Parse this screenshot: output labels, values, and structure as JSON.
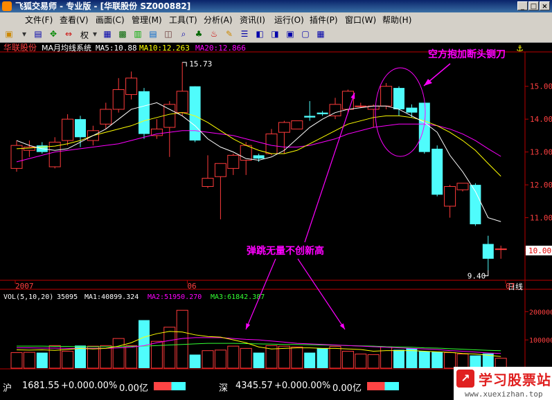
{
  "window": {
    "title": "飞狐交易师 - 专业版 - [华联股份 SZ000882]",
    "buttons": [
      "_",
      "□",
      "×"
    ]
  },
  "menu": [
    "文件(F)",
    "查看(V)",
    "画面(C)",
    "管理(M)",
    "工具(T)",
    "分析(A)",
    "资讯(I)",
    "运行(O)",
    "插件(P)",
    "窗口(W)",
    "帮助(H)"
  ],
  "toolbar": {
    "rights_label": "权"
  },
  "price_panel": {
    "stock_name": "华联股份",
    "indicator": "MA月均线系统",
    "ma5": "MA5:10.88",
    "ma10": "MA10:12.263",
    "ma20": "MA20:12.866",
    "high_label": "15.73",
    "low_label": "9.40",
    "last_price_tag": "10.00",
    "y_ticks": [
      "15.00",
      "14.00",
      "13.00",
      "12.00",
      "11.00",
      "10.00"
    ],
    "x_labels": [
      "2007",
      "06",
      "07"
    ],
    "period_label": "日线",
    "annotation_top": "空方抱加断头铡刀",
    "annotation_mid": "弹跳无量不创新高"
  },
  "volume_panel": {
    "indicator": "VOL(5,10,20)",
    "vol": "35095",
    "ma1": "MA1:40899.324",
    "ma2": "MA2:51950.270",
    "ma3": "MA3:61842.387",
    "y_ticks": [
      "200000",
      "100000"
    ]
  },
  "status": {
    "sh_label": "沪",
    "sh_value": "1681.55",
    "sh_change": "+0.00",
    "sh_pct": "0.00%",
    "sh_amount": "0.00亿",
    "sz_label": "深",
    "sz_value": "4345.57",
    "sz_change": "+0.00",
    "sz_pct": "0.00%",
    "sz_amount": "0.00亿"
  },
  "watermark": {
    "name": "学习股票站",
    "url": "www.xuexizhan.top"
  },
  "colors": {
    "up": "#ff3b3b",
    "down": "#4ffcfc",
    "ma5": "#ffffff",
    "ma10": "#ffff00",
    "ma20": "#ff00ff",
    "annotation": "#ff00ff"
  },
  "chart_data": {
    "type": "candlestick",
    "ylim": [
      9.2,
      15.9
    ],
    "volume_ylim": [
      0,
      240000
    ],
    "candles": [
      {
        "o": 12.5,
        "c": 13.2,
        "h": 13.35,
        "l": 12.4,
        "v": 55000
      },
      {
        "o": 13.05,
        "c": 13.15,
        "h": 13.35,
        "l": 12.85,
        "v": 56000
      },
      {
        "o": 13.2,
        "c": 13.0,
        "h": 13.3,
        "l": 12.95,
        "v": 55000
      },
      {
        "o": 12.55,
        "c": 13.3,
        "h": 13.45,
        "l": 12.5,
        "v": 80000
      },
      {
        "o": 13.35,
        "c": 14.0,
        "h": 14.15,
        "l": 13.2,
        "v": 60000
      },
      {
        "o": 14.0,
        "c": 13.45,
        "h": 14.1,
        "l": 13.15,
        "v": 80000
      },
      {
        "o": 13.35,
        "c": 13.65,
        "h": 13.8,
        "l": 13.2,
        "v": 78000
      },
      {
        "o": 13.85,
        "c": 14.3,
        "h": 14.5,
        "l": 13.7,
        "v": 80000
      },
      {
        "o": 14.3,
        "c": 14.9,
        "h": 15.25,
        "l": 14.2,
        "v": 105000
      },
      {
        "o": 14.75,
        "c": 15.25,
        "h": 15.45,
        "l": 14.6,
        "v": 80000
      },
      {
        "o": 14.85,
        "c": 13.55,
        "h": 14.95,
        "l": 13.4,
        "v": 170000
      },
      {
        "o": 13.5,
        "c": 13.7,
        "h": 14.0,
        "l": 13.4,
        "v": 95000
      },
      {
        "o": 13.75,
        "c": 14.45,
        "h": 14.55,
        "l": 12.85,
        "v": 145000
      },
      {
        "o": 14.2,
        "c": 14.85,
        "h": 15.73,
        "l": 14.1,
        "v": 205000
      },
      {
        "o": 15.0,
        "c": 13.35,
        "h": 15.0,
        "l": 13.3,
        "v": 48000
      },
      {
        "o": 11.95,
        "c": 12.2,
        "h": 12.9,
        "l": 11.9,
        "v": 62000
      },
      {
        "o": 12.25,
        "c": 12.65,
        "h": 12.65,
        "l": 10.95,
        "v": 64000
      },
      {
        "o": 12.5,
        "c": 12.9,
        "h": 12.95,
        "l": 12.3,
        "v": 78000
      },
      {
        "o": 12.75,
        "c": 13.2,
        "h": 13.3,
        "l": 12.3,
        "v": 70000
      },
      {
        "o": 12.9,
        "c": 12.8,
        "h": 12.95,
        "l": 12.7,
        "v": 55000
      },
      {
        "o": 12.95,
        "c": 13.55,
        "h": 13.7,
        "l": 12.9,
        "v": 80000
      },
      {
        "o": 13.6,
        "c": 13.9,
        "h": 13.95,
        "l": 12.95,
        "v": 78000
      },
      {
        "o": 13.7,
        "c": 13.95,
        "h": 13.95,
        "l": 13.7,
        "v": 75000
      },
      {
        "o": 14.1,
        "c": 14.05,
        "h": 14.55,
        "l": 13.95,
        "v": 55000
      },
      {
        "o": 14.2,
        "c": 14.15,
        "h": 14.25,
        "l": 14.1,
        "v": 70000
      },
      {
        "o": 14.1,
        "c": 14.45,
        "h": 14.65,
        "l": 14.0,
        "v": 77000
      },
      {
        "o": 14.3,
        "c": 14.85,
        "h": 14.9,
        "l": 14.2,
        "v": 60000
      },
      {
        "o": 14.4,
        "c": 14.4,
        "h": 14.5,
        "l": 14.35,
        "v": 50000
      },
      {
        "o": 14.3,
        "c": 14.4,
        "h": 14.45,
        "l": 13.75,
        "v": 48000
      },
      {
        "o": 14.4,
        "c": 15.0,
        "h": 15.1,
        "l": 14.3,
        "v": 75000
      },
      {
        "o": 14.95,
        "c": 14.3,
        "h": 15.0,
        "l": 14.1,
        "v": 65000
      },
      {
        "o": 14.35,
        "c": 14.2,
        "h": 14.45,
        "l": 14.05,
        "v": 70000
      },
      {
        "o": 14.5,
        "c": 13.0,
        "h": 14.5,
        "l": 12.95,
        "v": 60000
      },
      {
        "o": 13.1,
        "c": 11.7,
        "h": 13.2,
        "l": 11.65,
        "v": 58000
      },
      {
        "o": 11.35,
        "c": 11.95,
        "h": 12.0,
        "l": 11.0,
        "v": 55000
      },
      {
        "o": 11.85,
        "c": 12.05,
        "h": 12.05,
        "l": 11.8,
        "v": 50000
      },
      {
        "o": 12.0,
        "c": 10.8,
        "h": 12.05,
        "l": 10.75,
        "v": 45000
      },
      {
        "o": 10.2,
        "c": 9.75,
        "h": 10.45,
        "l": 9.4,
        "v": 52000
      },
      {
        "o": 10.05,
        "c": 10.05,
        "h": 10.15,
        "l": 9.75,
        "v": 35095
      }
    ],
    "ma5": [
      13.35,
      13.2,
      13.1,
      13.05,
      13.1,
      13.3,
      13.5,
      13.7,
      14.0,
      14.3,
      14.4,
      14.5,
      14.3,
      14.1,
      13.8,
      13.4,
      13.15,
      13.0,
      12.8,
      12.75,
      12.85,
      13.05,
      13.4,
      13.75,
      14.0,
      14.2,
      14.3,
      14.35,
      14.4,
      14.4,
      14.3,
      14.1,
      13.9,
      13.6,
      12.9,
      12.4,
      11.8,
      11.0,
      10.88
    ],
    "ma10": [
      13.1,
      13.12,
      13.15,
      13.18,
      13.25,
      13.35,
      13.5,
      13.6,
      13.7,
      13.8,
      13.95,
      14.05,
      14.15,
      14.2,
      14.1,
      13.9,
      13.65,
      13.4,
      13.2,
      13.05,
      12.95,
      12.95,
      13.05,
      13.25,
      13.45,
      13.65,
      13.85,
      13.95,
      14.05,
      14.1,
      14.1,
      14.05,
      13.95,
      13.8,
      13.6,
      13.35,
      13.05,
      12.65,
      12.263
    ],
    "ma20": [
      12.7,
      12.8,
      12.9,
      13.0,
      13.05,
      13.1,
      13.15,
      13.2,
      13.25,
      13.35,
      13.45,
      13.55,
      13.6,
      13.65,
      13.65,
      13.6,
      13.55,
      13.5,
      13.4,
      13.3,
      13.2,
      13.15,
      13.15,
      13.2,
      13.3,
      13.4,
      13.55,
      13.65,
      13.75,
      13.8,
      13.85,
      13.85,
      13.85,
      13.8,
      13.7,
      13.55,
      13.35,
      13.1,
      12.866
    ],
    "vol_ma1": [
      65000,
      64000,
      65000,
      63000,
      66000,
      70000,
      68000,
      70000,
      78000,
      90000,
      110000,
      122000,
      130000,
      128000,
      118000,
      112000,
      110000,
      100000,
      90000,
      75000,
      68000,
      70000,
      72000,
      72000,
      70000,
      70000,
      68000,
      66000,
      60000,
      62000,
      62000,
      62000,
      60000,
      58000,
      56000,
      52000,
      50000,
      46000,
      40899
    ],
    "vol_ma2": [
      72000,
      72000,
      71000,
      71000,
      70000,
      70000,
      70000,
      70000,
      72000,
      74000,
      80000,
      90000,
      98000,
      105000,
      108000,
      108000,
      108000,
      105000,
      102000,
      100000,
      96000,
      92000,
      88000,
      86000,
      84000,
      82000,
      80000,
      78000,
      76000,
      74000,
      72000,
      70000,
      68000,
      66000,
      62000,
      60000,
      57000,
      54000,
      51950
    ],
    "vol_ma3": [
      78000,
      78000,
      78000,
      77000,
      77000,
      76000,
      76000,
      76000,
      76000,
      77000,
      78000,
      80000,
      82000,
      84000,
      86000,
      88000,
      88000,
      88000,
      87000,
      86000,
      85000,
      84000,
      84000,
      83000,
      82000,
      81000,
      80000,
      79000,
      78000,
      76000,
      75000,
      74000,
      72000,
      71000,
      69000,
      67000,
      65000,
      63000,
      61842
    ]
  }
}
